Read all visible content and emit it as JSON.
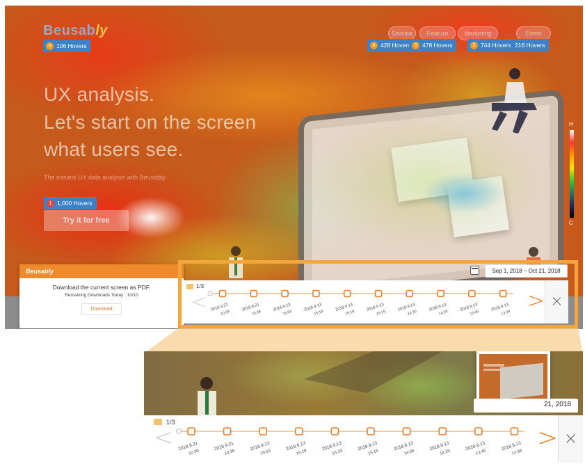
{
  "brand": {
    "logo_main": "Beusab",
    "logo_tail": "ly",
    "panel_logo": "Beusably"
  },
  "hero": {
    "line1": "UX analysis.",
    "line2": "Let's start on the screen",
    "line3": "what users see.",
    "subtitle": "The easiest UX data analysis with Beusably.",
    "cta": "Try it for free"
  },
  "hover_badges": [
    {
      "rank": "9",
      "label": "106 Hovers"
    },
    {
      "rank": "4",
      "label": "428 Hovers"
    },
    {
      "rank": "3",
      "label": "478 Hovers"
    },
    {
      "rank": "2",
      "label": "744 Hovers"
    },
    {
      "rank": "",
      "label": "216 Hovers"
    },
    {
      "rank": "1",
      "label": "1,000 Hovers"
    }
  ],
  "nav": [
    "Service",
    "Feature",
    "Marketing",
    "Event"
  ],
  "gauge": {
    "high": "H",
    "low": "C"
  },
  "pdf_panel": {
    "title": "Download the current screen as PDF.",
    "remaining": "Remaining Downloads Today : 10/10",
    "button": "Download"
  },
  "date_range": {
    "full": "Sep 1, 2018 ~ Oct 21, 2018",
    "partial": "21, 2018"
  },
  "timeline": {
    "page": "1/3",
    "prev": "<",
    "next": ">",
    "close": "×",
    "points": [
      {
        "date": "2018.9.21",
        "time": "10:39"
      },
      {
        "date": "2018.9.21",
        "time": "10:38"
      },
      {
        "date": "2018.9.13",
        "time": "15:50"
      },
      {
        "date": "2018.9.13",
        "time": "15:19"
      },
      {
        "date": "2018.9.13",
        "time": "15:19"
      },
      {
        "date": "2018.9.13",
        "time": "15:15"
      },
      {
        "date": "2018.9.13",
        "time": "14:30"
      },
      {
        "date": "2018.9.13",
        "time": "14:29"
      },
      {
        "date": "2018.9.13",
        "time": "13:40"
      },
      {
        "date": "2018.9.13",
        "time": "13:39"
      }
    ]
  },
  "colors": {
    "accent": "#f5a53a",
    "badge": "#3c82c9",
    "arrow": "#f07d22"
  }
}
